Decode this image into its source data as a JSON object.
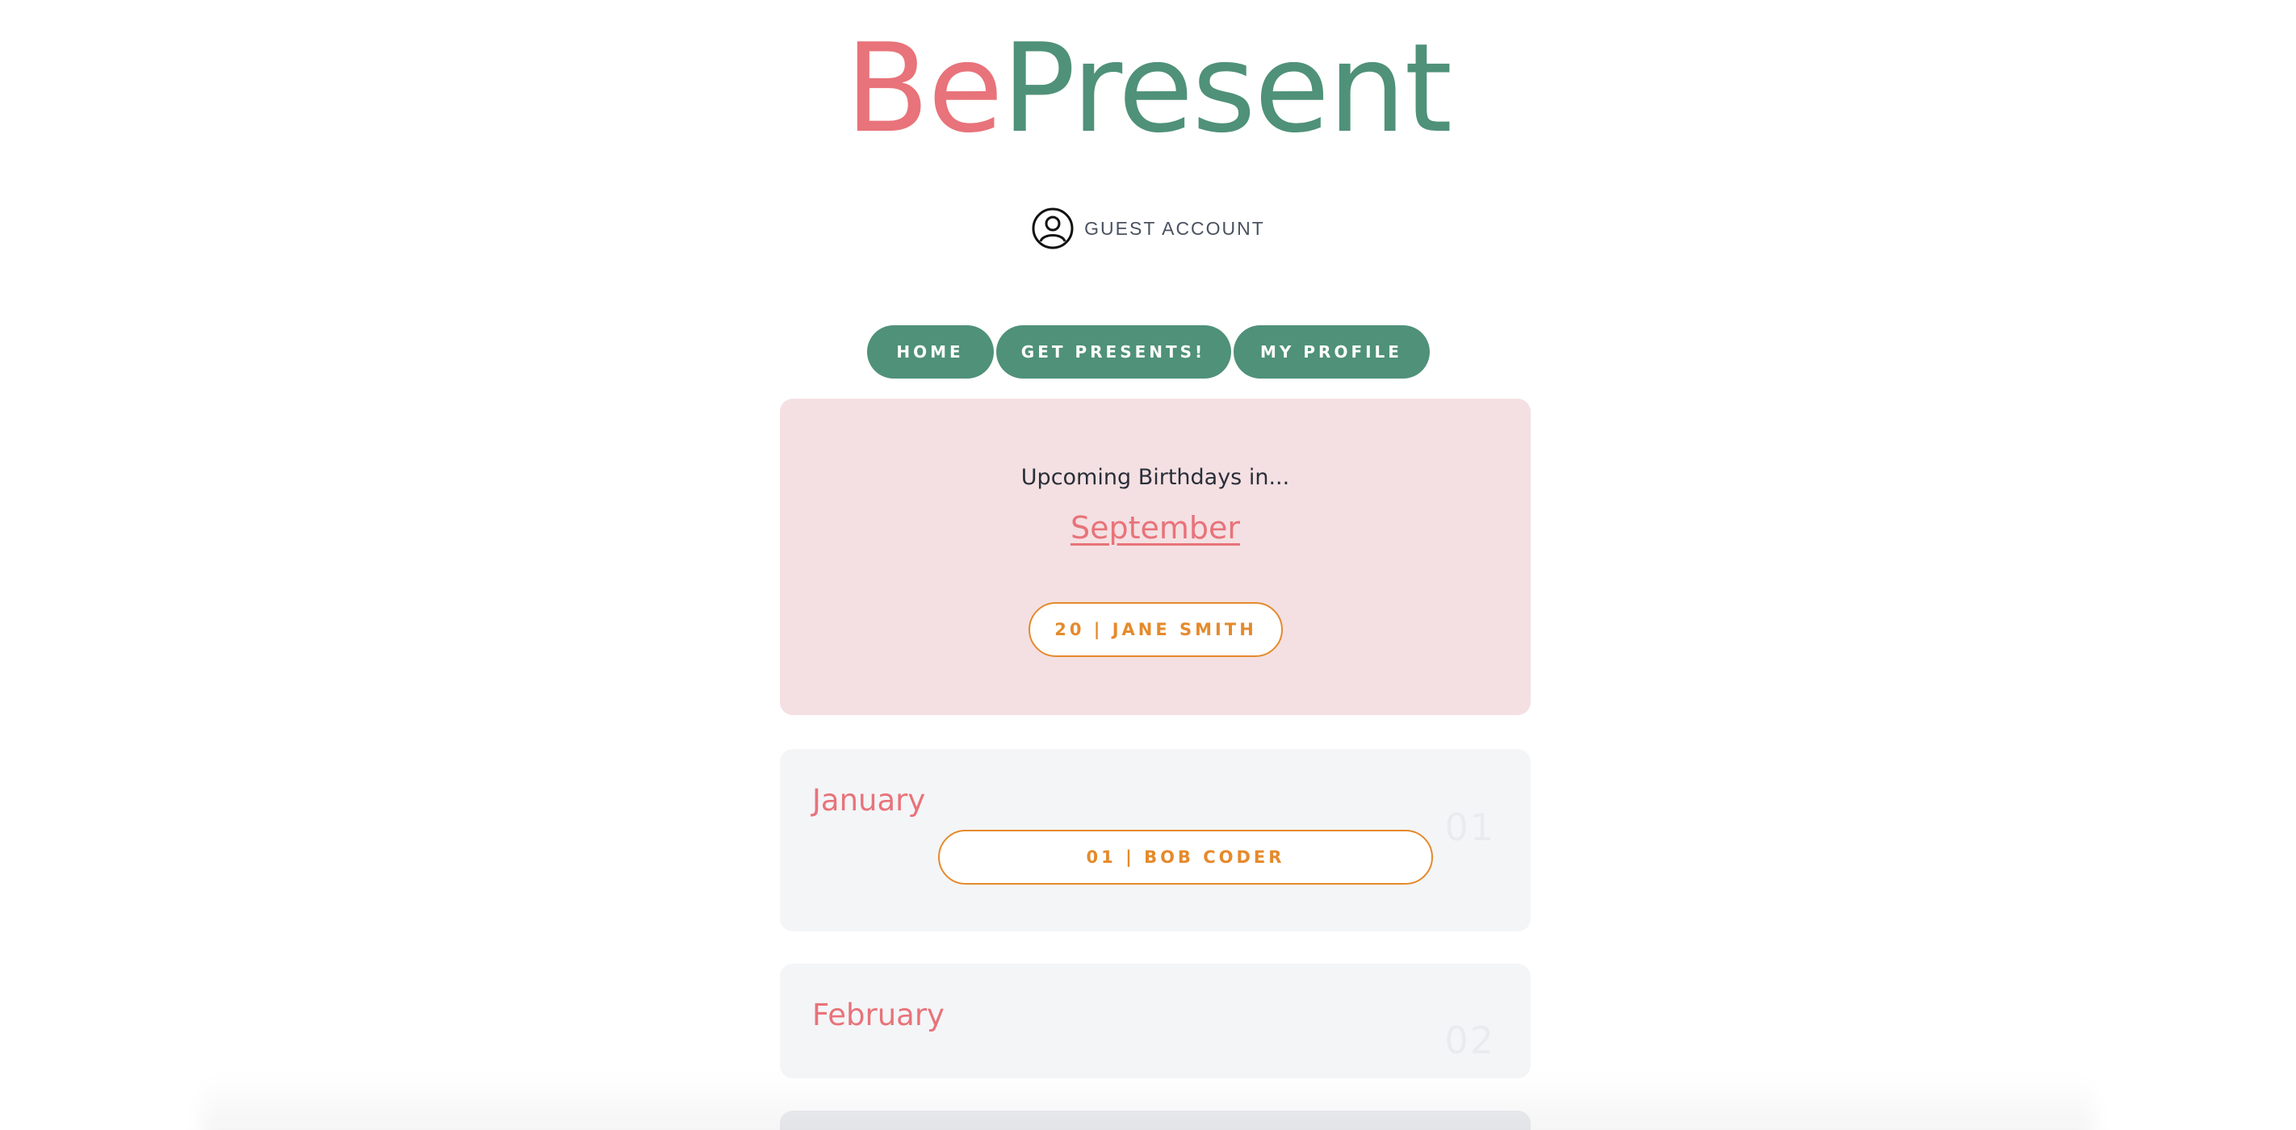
{
  "logo": {
    "part1": "Be",
    "part2": "Present"
  },
  "account": {
    "label": "GUEST ACCOUNT",
    "icon": "user-circle-icon"
  },
  "nav": {
    "home": "HOME",
    "get_presents": "GET PRESENTS!",
    "my_profile": "MY PROFILE"
  },
  "upcoming": {
    "title": "Upcoming Birthdays in...",
    "month": "September",
    "entries": [
      {
        "label": "20 | JANE SMITH"
      }
    ]
  },
  "months": [
    {
      "name": "January",
      "number": "01",
      "entries": [
        {
          "label": "01 | BOB CODER"
        }
      ]
    },
    {
      "name": "February",
      "number": "02",
      "entries": []
    }
  ],
  "colors": {
    "brand_pink": "#e8737a",
    "brand_green": "#4f9179",
    "accent_orange": "#e58a2c",
    "upcoming_bg": "#f4e0e2",
    "card_bg": "#f4f5f7"
  }
}
